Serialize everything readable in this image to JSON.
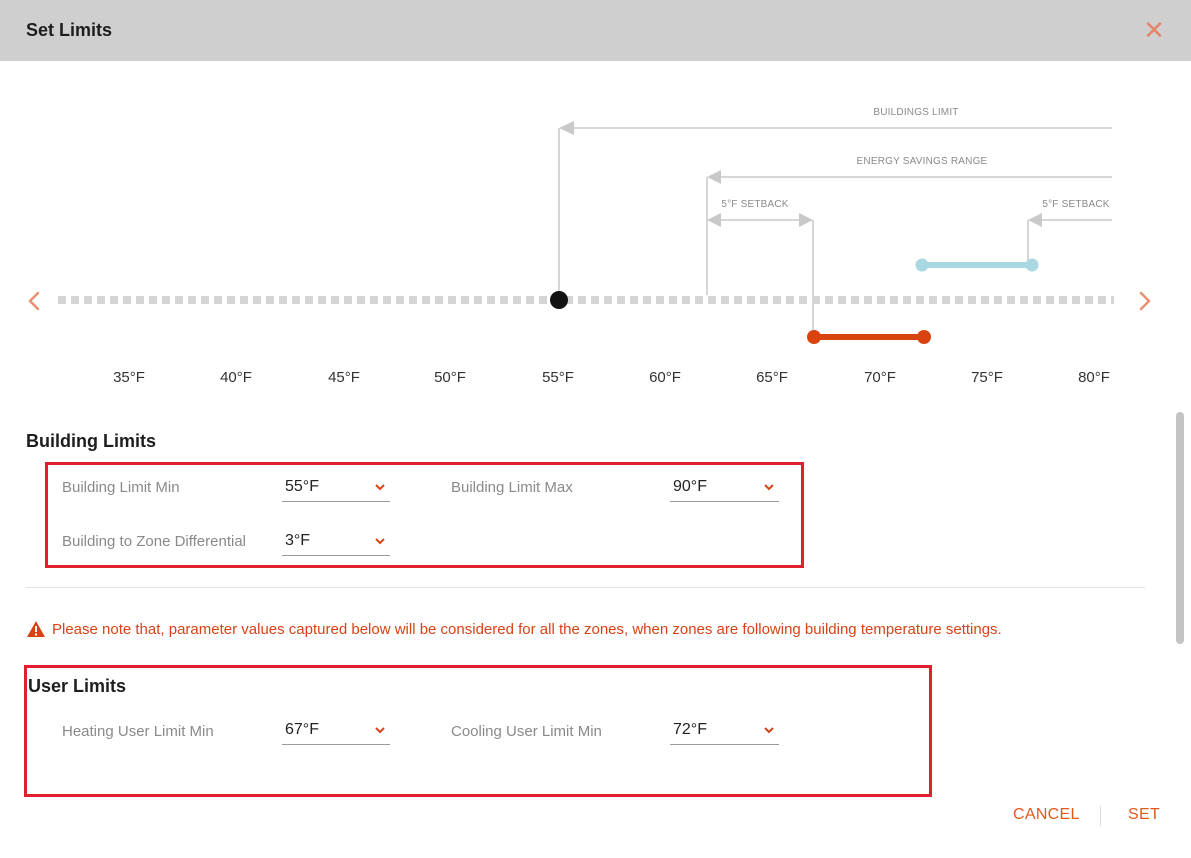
{
  "dialog": {
    "title": "Set Limits",
    "close_icon": "close-icon"
  },
  "scale": {
    "ticks": [
      "35°F",
      "40°F",
      "45°F",
      "50°F",
      "55°F",
      "60°F",
      "65°F",
      "70°F",
      "75°F",
      "80°F"
    ],
    "annotations": {
      "buildings_limit": "BUILDINGS LIMIT",
      "energy_savings_range": "ENERGY SAVINGS RANGE",
      "setback_left": "5°F SETBACK",
      "setback_right": "5°F SETBACK"
    },
    "marker_value": 55,
    "heating_range": [
      67,
      72
    ],
    "cooling_range": [
      72,
      77
    ],
    "colors": {
      "track": "#d5d5d5",
      "marker": "#111111",
      "heating": "#d94310",
      "cooling": "#a9d8e3",
      "annotation": "#c9c9c9"
    }
  },
  "building_limits": {
    "title": "Building Limits",
    "min_label": "Building Limit Min",
    "min_value": "55°F",
    "max_label": "Building Limit Max",
    "max_value": "90°F",
    "diff_label": "Building to Zone Differential",
    "diff_value": "3°F"
  },
  "notice": {
    "icon": "warning-icon",
    "text": "Please note that, parameter values captured below will be considered for all the zones, when zones are following building temperature settings."
  },
  "user_limits": {
    "title": "User Limits",
    "heating_label": "Heating User Limit Min",
    "heating_value": "67°F",
    "cooling_label": "Cooling User Limit Min",
    "cooling_value": "72°F"
  },
  "footer": {
    "cancel_label": "CANCEL",
    "set_label": "SET"
  }
}
